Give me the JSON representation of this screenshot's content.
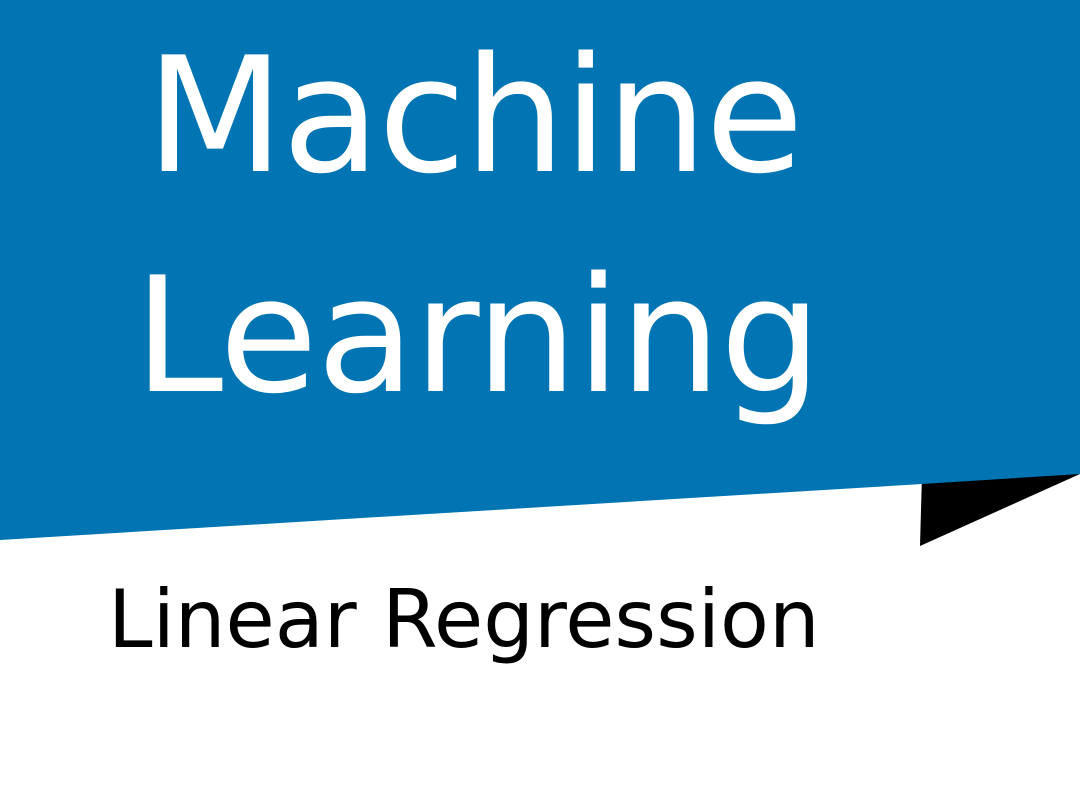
{
  "title": {
    "line1": "Machine",
    "line2": "Learning"
  },
  "subtitle": "Linear Regression",
  "colors": {
    "banner": "#0174b3",
    "fold": "#000000",
    "title_text": "#ffffff",
    "subtitle_text": "#000000",
    "background": "#ffffff"
  }
}
